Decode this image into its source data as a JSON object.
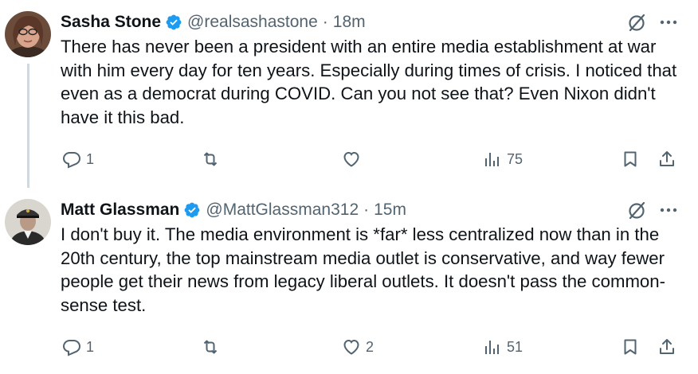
{
  "tweets": [
    {
      "author_name": "Sasha Stone",
      "handle": "@realsashastone",
      "separator": "·",
      "time": "18m",
      "text": "There has never been a president with an entire media establishment at war with him every day for ten years. Especially during times of crisis. I noticed that even as a democrat during COVID. Can you not see that? Even Nixon didn't have it this bad.",
      "replies": "1",
      "reposts": "",
      "likes": "",
      "views": "75"
    },
    {
      "author_name": "Matt Glassman",
      "handle": "@MattGlassman312",
      "separator": "·",
      "time": "15m",
      "text": "I don't buy it. The media environment is *far* less centralized now than in the 20th century, the top mainstream media outlet is conservative, and way fewer people get their news from legacy liberal outlets. It doesn't pass the common-sense test.",
      "replies": "1",
      "reposts": "",
      "likes": "2",
      "views": "51"
    }
  ],
  "colors": {
    "text": "#0f1419",
    "secondary": "#536471",
    "verified": "#1d9bf0",
    "thread_line": "#cfd9de"
  },
  "icons": [
    "reply-icon",
    "repost-icon",
    "like-icon",
    "views-icon",
    "bookmark-icon",
    "share-icon",
    "grok-icon",
    "more-icon",
    "verified-badge-icon"
  ]
}
